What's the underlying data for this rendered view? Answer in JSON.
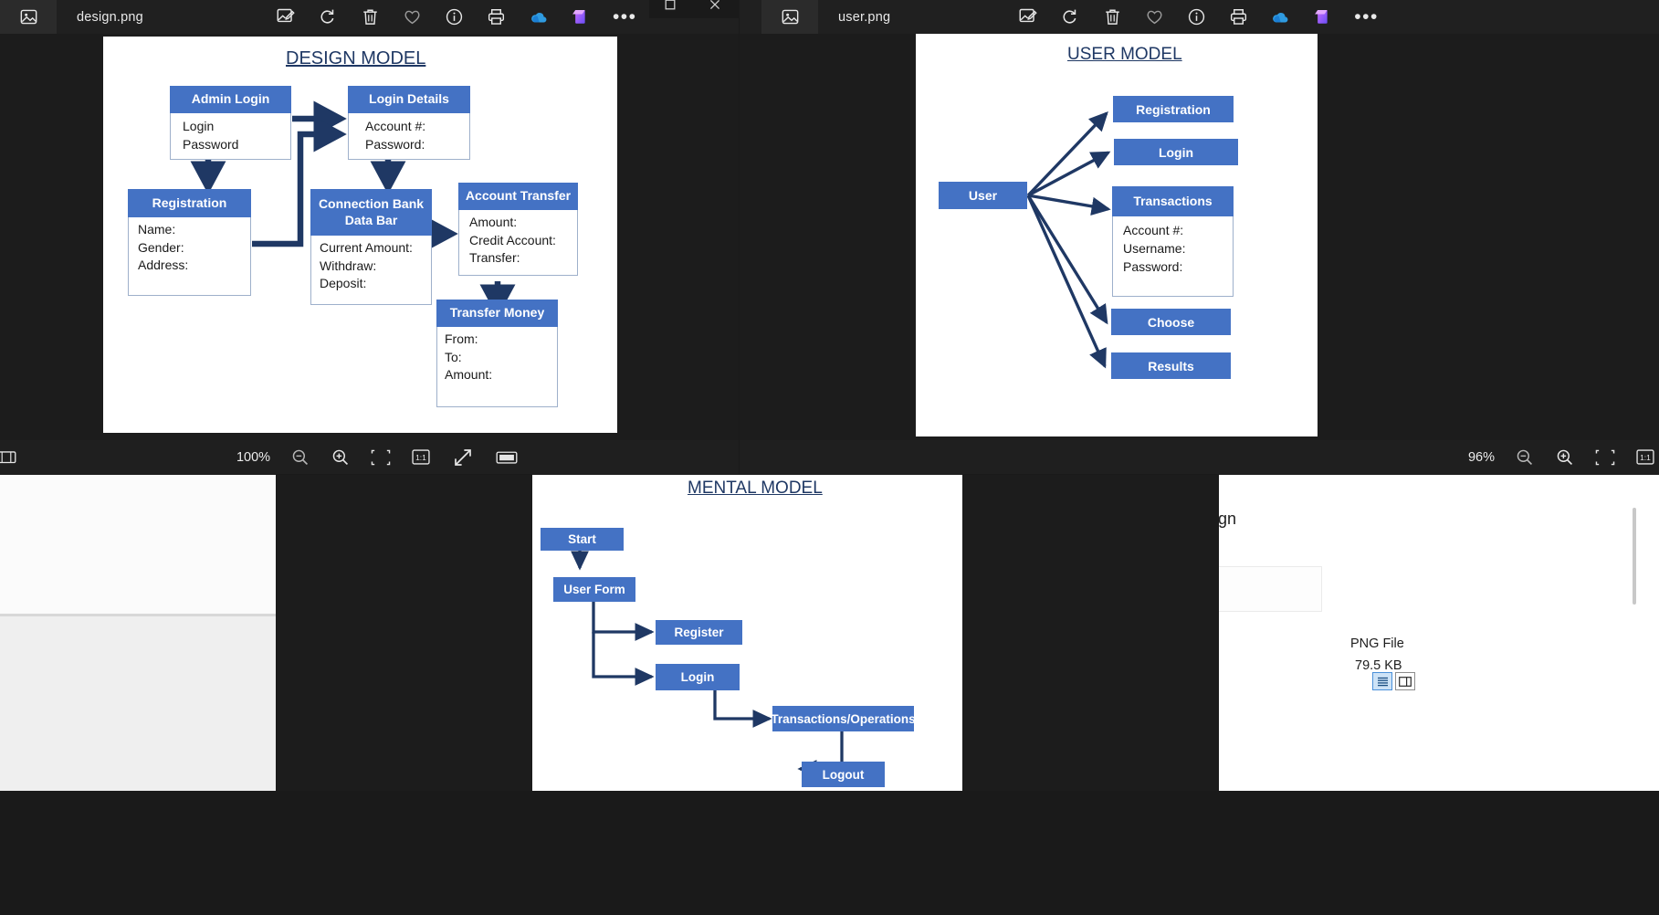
{
  "theme": {
    "accent_blue": "#4472c4",
    "arrow_navy": "#1f3864",
    "title_blue": "#1f3864",
    "toolbar_bg": "#202020",
    "canvas_bg": "#1c1c1c"
  },
  "window_design": {
    "file_name": "design.png",
    "zoom_level": "100%",
    "icons": [
      "image-thumbnail-icon",
      "edit-image-icon",
      "rotate-icon",
      "delete-icon",
      "favorite-heart-icon",
      "info-icon",
      "print-icon",
      "onedrive-icon",
      "designer-icon",
      "more-options-icon"
    ],
    "status_icons": [
      "filmstrip-icon",
      "zoom-out-icon",
      "zoom-in-icon",
      "fit-to-window-icon",
      "actual-size-icon",
      "fullscreen-icon",
      "slideshow-icon"
    ]
  },
  "window_user": {
    "file_name": "user.png",
    "zoom_level": "96%",
    "icons": [
      "image-thumbnail-icon",
      "edit-image-icon",
      "rotate-icon",
      "delete-icon",
      "favorite-heart-icon",
      "info-icon",
      "print-icon",
      "onedrive-icon",
      "designer-icon",
      "more-options-icon"
    ],
    "status_icons": [
      "zoom-out-icon",
      "zoom-in-icon",
      "fit-to-window-icon",
      "actual-size-icon"
    ],
    "caption_titlebar": [
      "restore-icon",
      "close-icon"
    ]
  },
  "explorer": {
    "file_type": "PNG File",
    "file_size": "79.5 KB",
    "partial_text": "gn",
    "view_buttons": [
      "details-pane-icon",
      "preview-pane-icon"
    ]
  },
  "design_model": {
    "title": "DESIGN MODEL",
    "nodes": [
      {
        "id": "admin_login",
        "header": "Admin Login",
        "fields": [
          "Login",
          "Password"
        ]
      },
      {
        "id": "login_details",
        "header": "Login Details",
        "fields": [
          "Account #:",
          "Password:"
        ]
      },
      {
        "id": "registration",
        "header": "Registration",
        "fields": [
          "Name:",
          "Gender:",
          "Address:"
        ]
      },
      {
        "id": "connection_bank",
        "header": "Connection Bank Data Bar",
        "header_lines": [
          "Connection Bank",
          "Data Bar"
        ],
        "fields": [
          "Current Amount:",
          "Withdraw:",
          "Deposit:"
        ]
      },
      {
        "id": "account_transfer",
        "header": "Account Transfer",
        "fields": [
          "Amount:",
          "Credit Account:",
          "Transfer:"
        ]
      },
      {
        "id": "transfer_money",
        "header": "Transfer Money",
        "fields": [
          "From:",
          "To:",
          "Amount:"
        ]
      }
    ],
    "edges": [
      {
        "from": "admin_login",
        "to": "login_details"
      },
      {
        "from": "admin_login",
        "to": "registration"
      },
      {
        "from": "login_details",
        "to": "connection_bank"
      },
      {
        "from": "registration",
        "to": "login_details"
      },
      {
        "from": "connection_bank",
        "to": "account_transfer"
      },
      {
        "from": "account_transfer",
        "to": "transfer_money"
      }
    ]
  },
  "user_model": {
    "title": "USER MODEL",
    "root": {
      "id": "user",
      "label": "User"
    },
    "nodes": [
      {
        "id": "registration",
        "header": "Registration",
        "fields": []
      },
      {
        "id": "login",
        "header": "Login",
        "fields": []
      },
      {
        "id": "transactions",
        "header": "Transactions",
        "fields": [
          "Account #:",
          "Username:",
          "Password:"
        ]
      },
      {
        "id": "choose",
        "header": "Choose",
        "fields": []
      },
      {
        "id": "results",
        "header": "Results",
        "fields": []
      }
    ],
    "edges": [
      {
        "from": "user",
        "to": "registration"
      },
      {
        "from": "user",
        "to": "login"
      },
      {
        "from": "user",
        "to": "transactions"
      },
      {
        "from": "user",
        "to": "choose"
      },
      {
        "from": "user",
        "to": "results"
      }
    ]
  },
  "mental_model": {
    "title": "MENTAL MODEL",
    "nodes": [
      {
        "id": "start",
        "label": "Start"
      },
      {
        "id": "user_form",
        "label": "User Form"
      },
      {
        "id": "register",
        "label": "Register"
      },
      {
        "id": "login",
        "label": "Login"
      },
      {
        "id": "transactions_operations",
        "label": "Transactions/Operations"
      },
      {
        "id": "logout",
        "label": "Logout"
      }
    ],
    "edges": [
      {
        "from": "start",
        "to": "user_form"
      },
      {
        "from": "user_form",
        "to": "register"
      },
      {
        "from": "user_form",
        "to": "login"
      },
      {
        "from": "login",
        "to": "transactions_operations"
      },
      {
        "from": "transactions_operations",
        "to": "logout"
      }
    ]
  }
}
